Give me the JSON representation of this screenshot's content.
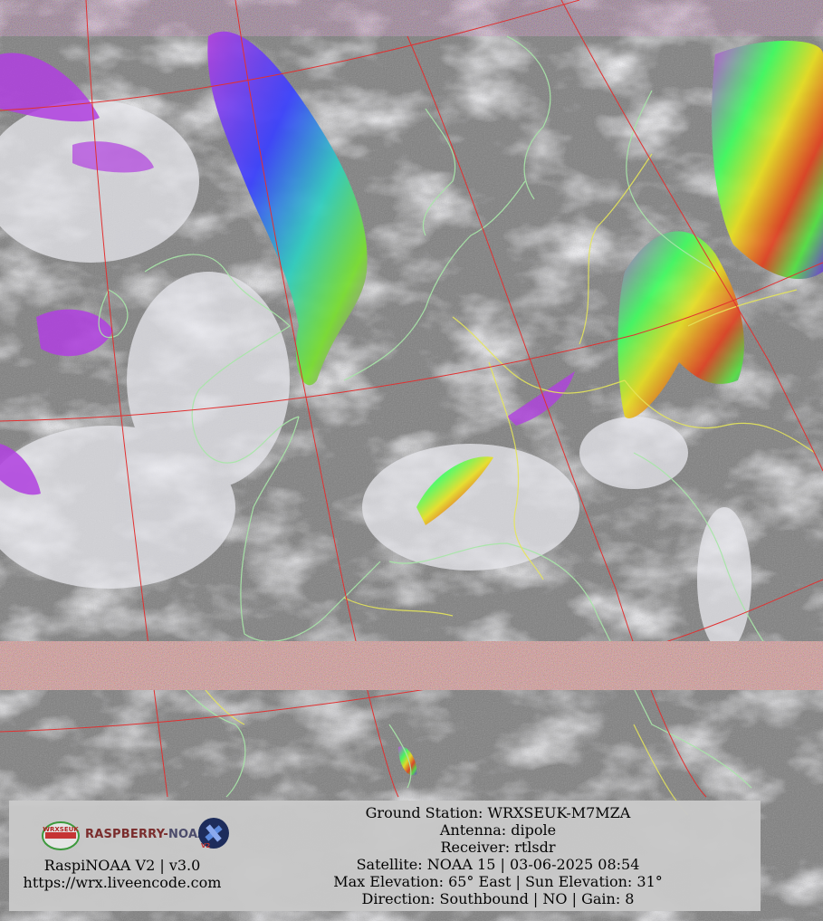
{
  "overlay": {
    "logo_wrx": "WRXSEUK",
    "logo_raspberry": "RASPBERRY-",
    "logo_noaa": "NOAA",
    "logo_v2": "V2",
    "software_version": "RaspiNOAA V2 | v3.0",
    "website": "https://wrx.liveencode.com",
    "ground_station": "Ground Station: WRXSEUK-M7MZA",
    "antenna": "Antenna: dipole",
    "receiver": "Receiver: rtlsdr",
    "satellite": "Satellite: NOAA 15 | 03-06-2025 08:54",
    "elevation": "Max Elevation: 65° East | Sun Elevation: 31°",
    "direction": "Direction: Southbound | NO | Gain: 8"
  },
  "colors": {
    "graticule": "#e23030",
    "coastline": "#a8e6a8",
    "borders": "#e6e65a",
    "cloud_high": "#b040e0",
    "noise_band": "#d8a070",
    "caption_bg": "#c9c9c9"
  }
}
